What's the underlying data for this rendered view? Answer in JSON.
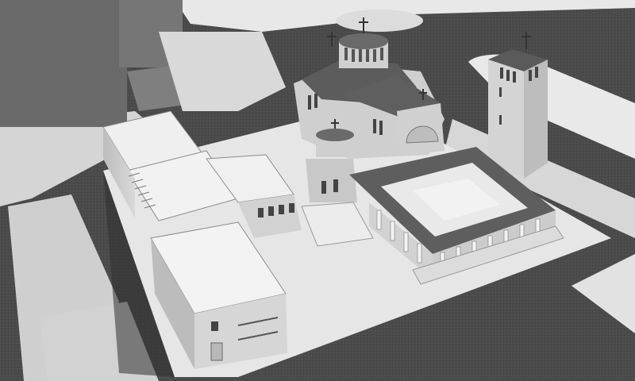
{
  "image": {
    "subject": "greyscale-3d-architectural-model",
    "palette": {
      "asphalt": "#4a4a4a",
      "plaza": "#e6e6e6",
      "roof": "#5e5e5e",
      "wall": "#c9c9c9",
      "shadow": "#2f2f2f"
    }
  }
}
